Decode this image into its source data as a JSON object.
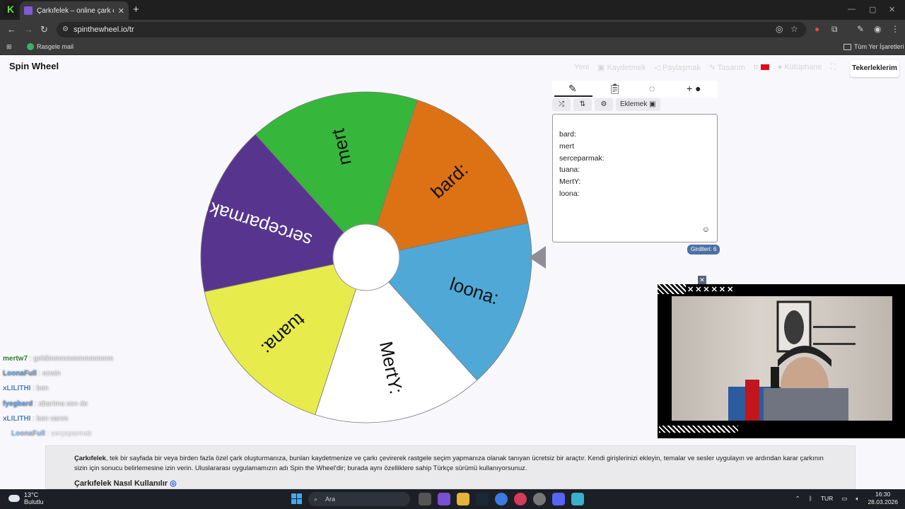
{
  "browser": {
    "tab_title": "Çarkıfelek – online çark çevirme",
    "url": "spinthewheel.io/tr",
    "bookmark_1": "Rasgele mail",
    "bookmark_all": "Tüm Yer İşaretleri",
    "ext_badge": "35"
  },
  "site": {
    "logo": "Spin Wheel",
    "nav": {
      "new": "Yeni",
      "save": "Kaydetmek",
      "share": "Paylaşmak",
      "design": "Tasarım",
      "lang": "tr",
      "library": "Kütüphane"
    },
    "my_wheels": "Tekerleklerim"
  },
  "wheel": {
    "segments": [
      {
        "label": "bard:",
        "color": "#dd7215"
      },
      {
        "label": "loona:",
        "color": "#50a8d6"
      },
      {
        "label": "MertY:",
        "color": "#ffffff"
      },
      {
        "label": "tuana:",
        "color": "#e7eb4c"
      },
      {
        "label": "serceparmak:",
        "color": "#57358f"
      },
      {
        "label": "mert",
        "color": "#36b73b"
      }
    ]
  },
  "editor": {
    "add_button": "Eklemek",
    "entries": [
      "bard:",
      "mert",
      "serceparmak:",
      "tuana:",
      "MertY:",
      "loona:"
    ],
    "count_label": "Girdileri: 6"
  },
  "chat": [
    {
      "user": "mertw7",
      "msg": "geldimmmmmmmmmmm"
    },
    {
      "user": "LoonaFull",
      "msg": "ezwin"
    },
    {
      "user": "xLILITHI",
      "msg": "ben"
    },
    {
      "user": "fyegbard",
      "msg": "abartma sen de"
    },
    {
      "user": "xLILITHI",
      "msg": "ben varım"
    },
    {
      "user": "LoonaFull",
      "msg": "serçeparmak"
    }
  ],
  "about": {
    "brand": "Çarkıfelek",
    "text": ", tek bir sayfada bir veya birden fazla özel çark oluşturmanıza, bunları kaydetmenize ve çarkı çevirerek rastgele seçim yapmanıza olanak tanıyan ücretsiz bir araçtır. Kendi girişlerinizi ekleyin, temalar ve sesler uygulayın ve ardından karar çarkının sizin için sonucu belirlemesine izin verin. Uluslararası uygulamamızın adı Spin the Wheel'dir; burada aynı özelliklere sahip Türkçe sürümü kullanıyorsunuz.",
    "howto": "Çarkıfelek Nasıl Kullanılır"
  },
  "taskbar": {
    "temp": "13°C",
    "weather": "Bulutlu",
    "search": "Ara",
    "lang": "TUR",
    "time": "16:30",
    "date": "28.03.2026"
  }
}
